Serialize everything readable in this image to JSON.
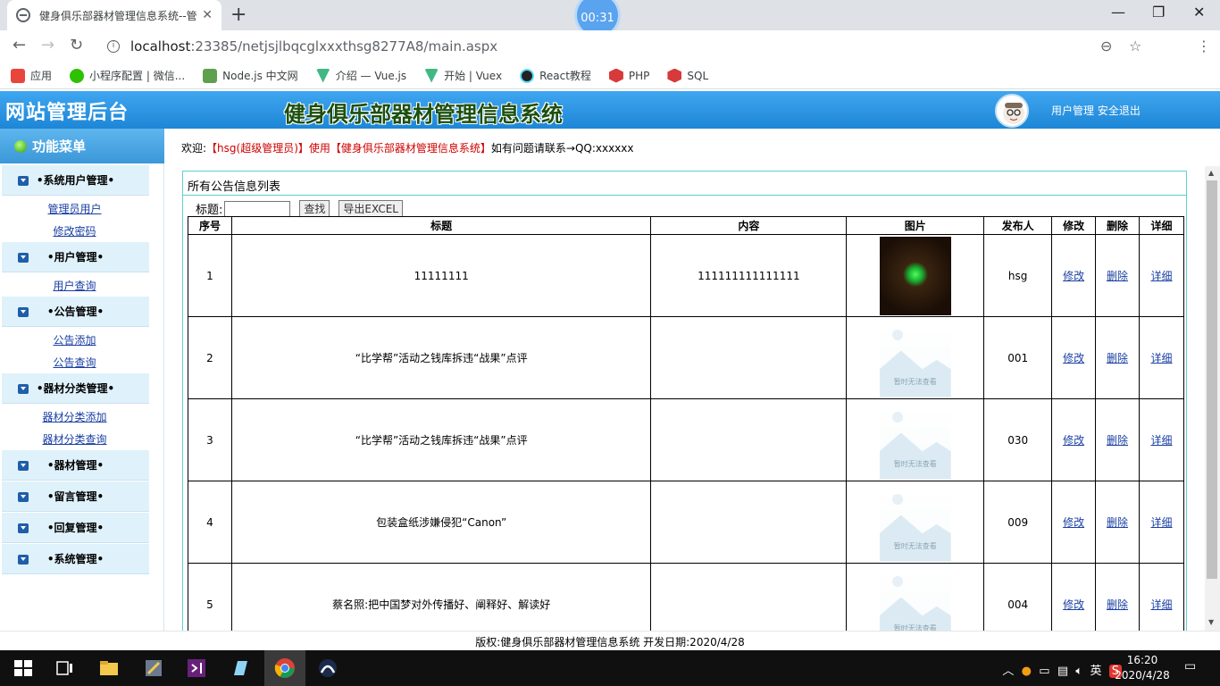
{
  "browser": {
    "tab_title": "健身俱乐部器材管理信息系统--管",
    "timer": "00:31",
    "url_host": "localhost",
    "url_rest": ":23385/netjsjlbqcglxxxthsg8277A8/main.aspx",
    "bookmarks": [
      {
        "label": "应用",
        "color": "#e8453c"
      },
      {
        "label": "小程序配置 | 微信...",
        "color": "#2dc100"
      },
      {
        "label": "Node.js 中文网",
        "color": "#5fa04e"
      },
      {
        "label": "介绍 — Vue.js",
        "color": "#41b883"
      },
      {
        "label": "开始 | Vuex",
        "color": "#41b883"
      },
      {
        "label": "React教程",
        "color": "#222222"
      },
      {
        "label": "PHP",
        "color": "#d73a3a"
      },
      {
        "label": "SQL",
        "color": "#d73a3a"
      }
    ]
  },
  "header": {
    "site_admin": "网站管理后台",
    "system_title": "健身俱乐部器材管理信息系统",
    "user_manage": "用户管理",
    "logout": "安全退出"
  },
  "menu": {
    "title": "功能菜单",
    "groups": [
      {
        "label": "•系统用户管理•",
        "links": [
          "管理员用户",
          "修改密码"
        ]
      },
      {
        "label": "•用户管理•",
        "links": [
          "用户查询"
        ]
      },
      {
        "label": "•公告管理•",
        "links": [
          "公告添加",
          "公告查询"
        ]
      },
      {
        "label": "•器材分类管理•",
        "links": [
          "器材分类添加",
          "器材分类查询"
        ]
      },
      {
        "label": "•器材管理•",
        "links": []
      },
      {
        "label": "•留言管理•",
        "links": []
      },
      {
        "label": "•回复管理•",
        "links": []
      },
      {
        "label": "•系统管理•",
        "links": []
      }
    ]
  },
  "welcome": {
    "prefix": "欢迎:",
    "user": "【hsg(超级管理员)】使用【健身俱乐部器材管理信息系统】",
    "suffix": "如有问题请联系→QQ:xxxxxx"
  },
  "panel": {
    "title": "所有公告信息列表",
    "search_label": "标题:",
    "search_button": "查找",
    "export_button": "导出EXCEL",
    "columns": [
      "序号",
      "标题",
      "内容",
      "图片",
      "发布人",
      "修改",
      "删除",
      "详细"
    ],
    "placeholder_caption": "暂时无法查看",
    "rows": [
      {
        "no": "1",
        "title": "11111111",
        "content": "111111111111111",
        "has_image": true,
        "publisher": "hsg",
        "edit": "修改",
        "delete": "删除",
        "detail": "详细"
      },
      {
        "no": "2",
        "title": "“比学帮”活动之钱库拆违“战果”点评",
        "content": "",
        "has_image": false,
        "publisher": "001",
        "edit": "修改",
        "delete": "删除",
        "detail": "详细"
      },
      {
        "no": "3",
        "title": "“比学帮”活动之钱库拆违“战果”点评",
        "content": "",
        "has_image": false,
        "publisher": "030",
        "edit": "修改",
        "delete": "删除",
        "detail": "详细"
      },
      {
        "no": "4",
        "title": "包装盒纸涉嫌侵犯“Canon”",
        "content": "",
        "has_image": false,
        "publisher": "009",
        "edit": "修改",
        "delete": "删除",
        "detail": "详细"
      },
      {
        "no": "5",
        "title": "蔡名照:把中国梦对外传播好、阐释好、解读好",
        "content": "",
        "has_image": false,
        "publisher": "004",
        "edit": "修改",
        "delete": "删除",
        "detail": "详细"
      }
    ]
  },
  "footer": {
    "text": "版权:健身俱乐部器材管理信息系统 开发日期:2020/4/28"
  },
  "taskbar": {
    "ime": "英",
    "time": "16:20",
    "date": "2020/4/28"
  }
}
